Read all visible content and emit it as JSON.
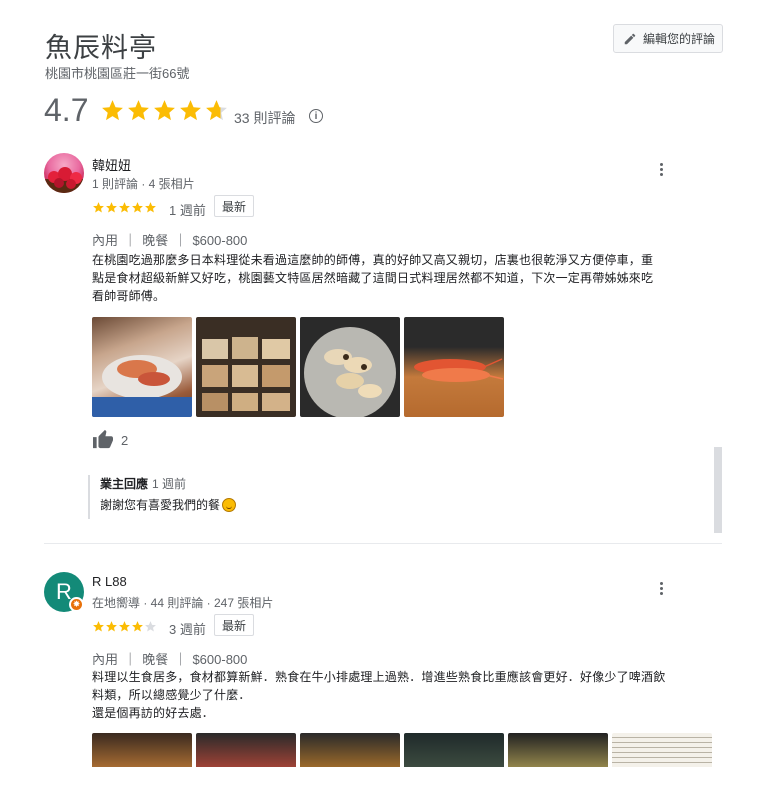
{
  "place": {
    "title": "魚辰料亭",
    "address": "桃園市桃園區莊一街66號",
    "edit_label": "編輯您的評論",
    "rating": "4.7",
    "rating_value": 4.7,
    "review_count_label": "33 則評論",
    "info_glyph": "i"
  },
  "reviews": [
    {
      "name": "韓妞妞",
      "meta": "1 則評論 · 4 張相片",
      "stars": 5,
      "time": "1 週前",
      "badge": "最新",
      "dine": "內用 ｜ 晚餐 ｜ $600-800",
      "text": "在桃園吃過那麼多日本料理從未看過這麼帥的師傅，真的好帥又高又親切，店裏也很乾淨又方便停車，重\n點是食材超級新鮮又好吃，桃園藝文特區居然暗藏了這間日式料理居然都不知道，下次一定再帶姊姊來吃\n看帥哥師傅。",
      "likes": "2",
      "owner_title": "業主回應",
      "owner_time": "1 週前",
      "owner_text": "謝謝您有喜愛我們的餐"
    },
    {
      "name": "R L88",
      "avatar_letter": "R",
      "meta": "在地嚮導 · 44 則評論 · 247 張相片",
      "stars": 4,
      "time": "3 週前",
      "badge": "最新",
      "dine": "內用 ｜ 晚餐 ｜ $600-800",
      "text": "料理以生食居多，食材都算新鮮．熟食在牛小排處理上過熟．增進些熟食比重應該會更好．好像少了啤酒飲\n料類，所以總感覺少了什麼．\n還是個再訪的好去處．"
    }
  ],
  "colors": {
    "star": "#fbbc04",
    "star_empty": "#dadce0",
    "text": "#202124",
    "muted": "#5f6368"
  }
}
